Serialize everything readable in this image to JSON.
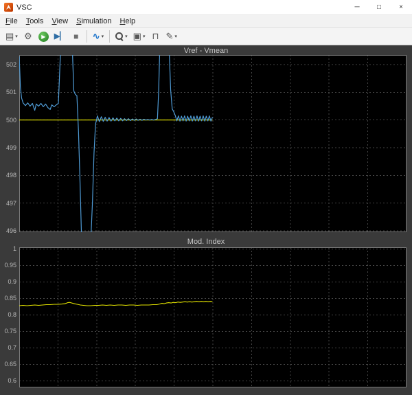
{
  "window": {
    "title": "VSC",
    "minimize_glyph": "─",
    "maximize_glyph": "□",
    "close_glyph": "×"
  },
  "menu": {
    "items": [
      {
        "label": "File"
      },
      {
        "label": "Tools"
      },
      {
        "label": "View"
      },
      {
        "label": "Simulation"
      },
      {
        "label": "Help"
      }
    ]
  },
  "toolbar": {
    "buttons": [
      {
        "name": "print-button",
        "icon": "printer-icon",
        "glyph": "▤",
        "dropdown": true
      },
      {
        "name": "settings-button",
        "icon": "gear-icon",
        "glyph": "⚙"
      },
      {
        "name": "run-button",
        "icon": "play-icon",
        "glyph": "▶",
        "style": "run"
      },
      {
        "name": "step-forward-button",
        "icon": "step-forward-icon",
        "glyph": "▶▏",
        "style": "step"
      },
      {
        "name": "stop-button",
        "icon": "stop-icon",
        "glyph": "■",
        "style": "stop"
      },
      {
        "name": "separator"
      },
      {
        "name": "signal-style-button",
        "icon": "signal-wave-icon",
        "glyph": "∿",
        "dropdown": true,
        "style": "style"
      },
      {
        "name": "separator"
      },
      {
        "name": "zoom-button",
        "icon": "magnifier-icon",
        "glyph": "magnifier",
        "dropdown": true
      },
      {
        "name": "autoscale-axes-button",
        "icon": "autoscale-icon",
        "glyph": "▣",
        "dropdown": true
      },
      {
        "name": "trigger-button",
        "icon": "trigger-pulse-icon",
        "glyph": "⊓"
      },
      {
        "name": "measurements-button",
        "icon": "pen-icon",
        "glyph": "✎",
        "dropdown": true
      }
    ]
  },
  "colors": {
    "yellow": "#e6e600",
    "blue": "#4f9bd5",
    "plot_bg": "#000000",
    "grid": "#454545",
    "axis_border": "#7c7c7c",
    "tick_text": "#b8b8b8",
    "title_text": "#c8c8c8",
    "scope_bg": "#3a3a3a"
  },
  "chart_data": [
    {
      "type": "line",
      "title": "Vref - Vmean",
      "ylim": [
        495.95,
        502.35
      ],
      "yticks": [
        "502",
        "501",
        "500",
        "499",
        "498",
        "497",
        "496"
      ],
      "xgrid_fracs": [
        0.1,
        0.2,
        0.3,
        0.4,
        0.5,
        0.6,
        0.7,
        0.8,
        0.9
      ],
      "grid": true,
      "legend": "none",
      "series": [
        {
          "name": "Vref",
          "color": "#e6e600",
          "width": 1.2,
          "points": [
            [
              0.0,
              500.0
            ],
            [
              0.499,
              500.0
            ]
          ]
        },
        {
          "name": "Vmean",
          "color": "#4f9bd5",
          "width": 1.2,
          "points": [
            [
              0.0,
              502.3
            ],
            [
              0.003,
              501.2
            ],
            [
              0.006,
              500.8
            ],
            [
              0.01,
              500.62
            ],
            [
              0.016,
              500.52
            ],
            [
              0.022,
              500.62
            ],
            [
              0.028,
              500.5
            ],
            [
              0.034,
              500.6
            ],
            [
              0.04,
              500.35
            ],
            [
              0.044,
              500.58
            ],
            [
              0.05,
              500.5
            ],
            [
              0.056,
              500.6
            ],
            [
              0.062,
              500.48
            ],
            [
              0.068,
              500.58
            ],
            [
              0.074,
              500.45
            ],
            [
              0.08,
              500.38
            ],
            [
              0.084,
              500.55
            ],
            [
              0.09,
              500.48
            ],
            [
              0.096,
              500.55
            ],
            [
              0.101,
              500.6
            ],
            [
              0.104,
              501.6
            ],
            [
              0.107,
              502.6
            ],
            [
              0.137,
              502.6
            ],
            [
              0.141,
              501.05
            ],
            [
              0.145,
              500.92
            ],
            [
              0.149,
              500.88
            ],
            [
              0.153,
              499.6
            ],
            [
              0.157,
              497.8
            ],
            [
              0.161,
              495.7
            ],
            [
              0.185,
              495.7
            ],
            [
              0.189,
              497.0
            ],
            [
              0.193,
              498.8
            ],
            [
              0.197,
              499.85
            ],
            [
              0.202,
              500.15
            ],
            [
              0.207,
              499.94
            ],
            [
              0.212,
              500.12
            ],
            [
              0.217,
              499.95
            ],
            [
              0.222,
              500.1
            ],
            [
              0.227,
              499.96
            ],
            [
              0.232,
              500.09
            ],
            [
              0.237,
              499.96
            ],
            [
              0.242,
              500.08
            ],
            [
              0.247,
              499.97
            ],
            [
              0.252,
              500.07
            ],
            [
              0.257,
              499.97
            ],
            [
              0.262,
              500.06
            ],
            [
              0.267,
              499.97
            ],
            [
              0.272,
              500.05
            ],
            [
              0.277,
              499.98
            ],
            [
              0.282,
              500.05
            ],
            [
              0.287,
              499.98
            ],
            [
              0.292,
              500.04
            ],
            [
              0.297,
              499.99
            ],
            [
              0.302,
              500.04
            ],
            [
              0.307,
              499.99
            ],
            [
              0.312,
              500.03
            ],
            [
              0.317,
              499.99
            ],
            [
              0.322,
              500.03
            ],
            [
              0.327,
              500.0
            ],
            [
              0.332,
              500.02
            ],
            [
              0.337,
              500.0
            ],
            [
              0.342,
              500.02
            ],
            [
              0.347,
              500.0
            ],
            [
              0.352,
              500.02
            ],
            [
              0.357,
              500.05
            ],
            [
              0.36,
              501.0
            ],
            [
              0.363,
              502.6
            ],
            [
              0.387,
              502.6
            ],
            [
              0.391,
              501.1
            ],
            [
              0.395,
              500.4
            ],
            [
              0.399,
              500.3
            ],
            [
              0.403,
              500.16
            ],
            [
              0.407,
              499.97
            ],
            [
              0.411,
              500.15
            ],
            [
              0.415,
              499.96
            ],
            [
              0.419,
              500.14
            ],
            [
              0.423,
              499.97
            ],
            [
              0.427,
              500.15
            ],
            [
              0.431,
              499.96
            ],
            [
              0.435,
              500.14
            ],
            [
              0.439,
              499.97
            ],
            [
              0.443,
              500.15
            ],
            [
              0.447,
              499.96
            ],
            [
              0.451,
              500.14
            ],
            [
              0.455,
              499.97
            ],
            [
              0.459,
              500.15
            ],
            [
              0.463,
              499.96
            ],
            [
              0.467,
              500.14
            ],
            [
              0.471,
              499.97
            ],
            [
              0.475,
              500.15
            ],
            [
              0.479,
              499.96
            ],
            [
              0.483,
              500.14
            ],
            [
              0.487,
              499.97
            ],
            [
              0.491,
              500.15
            ],
            [
              0.495,
              499.96
            ],
            [
              0.499,
              500.1
            ]
          ]
        }
      ]
    },
    {
      "type": "line",
      "title": "Mod. Index",
      "ylim": [
        0.58,
        1.005
      ],
      "yticks": [
        "1",
        "0.95",
        "0.9",
        "0.85",
        "0.8",
        "0.75",
        "0.7",
        "0.65",
        "0.6"
      ],
      "xgrid_fracs": [
        0.1,
        0.2,
        0.3,
        0.4,
        0.5,
        0.6,
        0.7,
        0.8,
        0.9
      ],
      "grid": true,
      "legend": "none",
      "series": [
        {
          "name": "Mod-Index",
          "color": "#e6e600",
          "width": 1.1,
          "points": [
            [
              0.0,
              0.828
            ],
            [
              0.01,
              0.829
            ],
            [
              0.02,
              0.828
            ],
            [
              0.03,
              0.829
            ],
            [
              0.04,
              0.83
            ],
            [
              0.05,
              0.829
            ],
            [
              0.06,
              0.83
            ],
            [
              0.07,
              0.831
            ],
            [
              0.08,
              0.831
            ],
            [
              0.09,
              0.832
            ],
            [
              0.1,
              0.832
            ],
            [
              0.11,
              0.833
            ],
            [
              0.118,
              0.834
            ],
            [
              0.125,
              0.837
            ],
            [
              0.13,
              0.838
            ],
            [
              0.136,
              0.836
            ],
            [
              0.142,
              0.834
            ],
            [
              0.15,
              0.832
            ],
            [
              0.158,
              0.83
            ],
            [
              0.166,
              0.829
            ],
            [
              0.175,
              0.828
            ],
            [
              0.185,
              0.828
            ],
            [
              0.195,
              0.829
            ],
            [
              0.205,
              0.829
            ],
            [
              0.215,
              0.83
            ],
            [
              0.225,
              0.829
            ],
            [
              0.235,
              0.83
            ],
            [
              0.245,
              0.829
            ],
            [
              0.255,
              0.83
            ],
            [
              0.265,
              0.83
            ],
            [
              0.275,
              0.829
            ],
            [
              0.285,
              0.83
            ],
            [
              0.295,
              0.83
            ],
            [
              0.305,
              0.829
            ],
            [
              0.315,
              0.83
            ],
            [
              0.325,
              0.83
            ],
            [
              0.335,
              0.83
            ],
            [
              0.345,
              0.831
            ],
            [
              0.355,
              0.831
            ],
            [
              0.362,
              0.833
            ],
            [
              0.368,
              0.835
            ],
            [
              0.374,
              0.834
            ],
            [
              0.38,
              0.836
            ],
            [
              0.386,
              0.837
            ],
            [
              0.392,
              0.836
            ],
            [
              0.398,
              0.838
            ],
            [
              0.404,
              0.837
            ],
            [
              0.41,
              0.839
            ],
            [
              0.416,
              0.838
            ],
            [
              0.422,
              0.839
            ],
            [
              0.428,
              0.84
            ],
            [
              0.434,
              0.839
            ],
            [
              0.44,
              0.84
            ],
            [
              0.446,
              0.839
            ],
            [
              0.452,
              0.84
            ],
            [
              0.458,
              0.841
            ],
            [
              0.464,
              0.84
            ],
            [
              0.47,
              0.841
            ],
            [
              0.476,
              0.84
            ],
            [
              0.482,
              0.841
            ],
            [
              0.488,
              0.84
            ],
            [
              0.494,
              0.841
            ],
            [
              0.499,
              0.84
            ]
          ]
        }
      ]
    }
  ]
}
